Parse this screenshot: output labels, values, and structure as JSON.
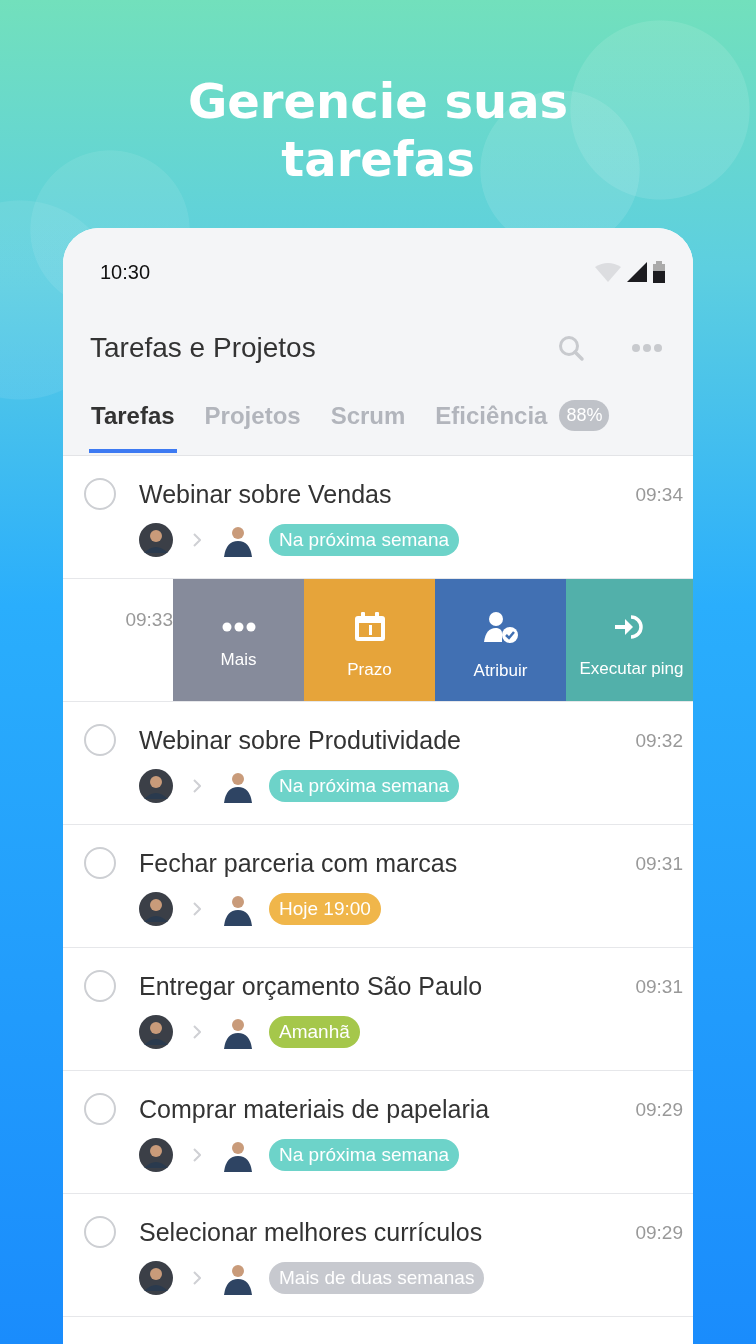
{
  "headline": "Gerencie suas tarefas",
  "status_bar": {
    "time": "10:30"
  },
  "header": {
    "title": "Tarefas e Projetos"
  },
  "tabs": [
    {
      "label": "Tarefas",
      "selected": true
    },
    {
      "label": "Projetos",
      "selected": false
    },
    {
      "label": "Scrum",
      "selected": false
    },
    {
      "label": "Eficiência",
      "selected": false,
      "badge": "88%"
    }
  ],
  "tasks": [
    {
      "kind": "task",
      "title": "Webinar sobre Vendas",
      "time": "09:34",
      "checked": false,
      "tag": "Na próxima semana",
      "color": "#6dd3c9"
    },
    {
      "kind": "swiped",
      "time": "09:33",
      "actions": [
        {
          "label": "Mais",
          "kind": "more",
          "color": "#868b9b"
        },
        {
          "label": "Prazo",
          "kind": "deadline",
          "color": "#e6a43a"
        },
        {
          "label": "Atribuir",
          "kind": "assign",
          "color": "#4170b3"
        },
        {
          "label": "Executar ping",
          "kind": "ping",
          "color": "#52b0aa"
        }
      ]
    },
    {
      "kind": "task",
      "title": "Webinar sobre Produtividade",
      "time": "09:32",
      "checked": false,
      "tag": "Na próxima semana",
      "color": "#6dd3c9"
    },
    {
      "kind": "task",
      "title": "Fechar parceria com marcas",
      "time": "09:31",
      "checked": false,
      "tag": "Hoje 19:00",
      "color": "#f0b64a"
    },
    {
      "kind": "task",
      "title": "Entregar orçamento São Paulo",
      "time": "09:31",
      "checked": false,
      "tag": "Amanhã",
      "color": "#a5c74b"
    },
    {
      "kind": "task",
      "title": "Comprar materiais de papelaria",
      "time": "09:29",
      "checked": false,
      "tag": "Na próxima semana",
      "color": "#6dd3c9"
    },
    {
      "kind": "task",
      "title": "Selecionar melhores currículos",
      "time": "09:29",
      "checked": false,
      "tag": "Mais de duas semanas",
      "color": "#c7c9cf"
    }
  ]
}
